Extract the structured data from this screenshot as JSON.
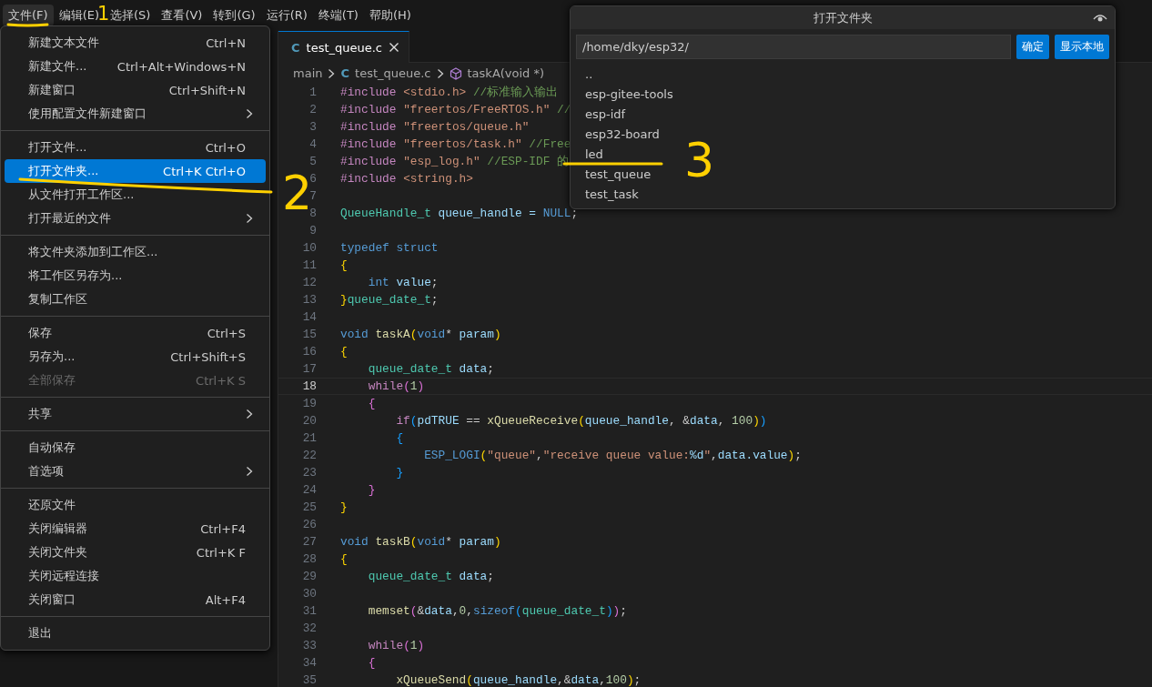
{
  "menu_bar": [
    {
      "label": "文件(F)",
      "selected": true
    },
    {
      "label": "编辑(E)",
      "selected": false
    },
    {
      "label": "选择(S)",
      "selected": false
    },
    {
      "label": "查看(V)",
      "selected": false
    },
    {
      "label": "转到(G)",
      "selected": false
    },
    {
      "label": "运行(R)",
      "selected": false
    },
    {
      "label": "终端(T)",
      "selected": false
    },
    {
      "label": "帮助(H)",
      "selected": false
    }
  ],
  "file_menu": [
    {
      "kind": "item",
      "label": "新建文本文件",
      "shortcut": "Ctrl+N",
      "submenu": false,
      "disabled": false,
      "selected": false
    },
    {
      "kind": "item",
      "label": "新建文件...",
      "shortcut": "Ctrl+Alt+Windows+N",
      "submenu": false,
      "disabled": false,
      "selected": false
    },
    {
      "kind": "item",
      "label": "新建窗口",
      "shortcut": "Ctrl+Shift+N",
      "submenu": false,
      "disabled": false,
      "selected": false
    },
    {
      "kind": "item",
      "label": "使用配置文件新建窗口",
      "submenu": true,
      "disabled": false,
      "selected": false
    },
    {
      "kind": "separator"
    },
    {
      "kind": "item",
      "label": "打开文件...",
      "shortcut": "Ctrl+O",
      "submenu": false,
      "disabled": false,
      "selected": false
    },
    {
      "kind": "item",
      "label": "打开文件夹...",
      "shortcut": "Ctrl+K Ctrl+O",
      "submenu": false,
      "disabled": false,
      "selected": true
    },
    {
      "kind": "item",
      "label": "从文件打开工作区...",
      "submenu": false,
      "disabled": false,
      "selected": false
    },
    {
      "kind": "item",
      "label": "打开最近的文件",
      "submenu": true,
      "disabled": false,
      "selected": false
    },
    {
      "kind": "separator"
    },
    {
      "kind": "item",
      "label": "将文件夹添加到工作区...",
      "submenu": false,
      "disabled": false,
      "selected": false
    },
    {
      "kind": "item",
      "label": "将工作区另存为...",
      "submenu": false,
      "disabled": false,
      "selected": false
    },
    {
      "kind": "item",
      "label": "复制工作区",
      "submenu": false,
      "disabled": false,
      "selected": false
    },
    {
      "kind": "separator"
    },
    {
      "kind": "item",
      "label": "保存",
      "shortcut": "Ctrl+S",
      "submenu": false,
      "disabled": false,
      "selected": false
    },
    {
      "kind": "item",
      "label": "另存为...",
      "shortcut": "Ctrl+Shift+S",
      "submenu": false,
      "disabled": false,
      "selected": false
    },
    {
      "kind": "item",
      "label": "全部保存",
      "shortcut": "Ctrl+K S",
      "submenu": false,
      "disabled": true,
      "selected": false
    },
    {
      "kind": "separator"
    },
    {
      "kind": "item",
      "label": "共享",
      "submenu": true,
      "disabled": false,
      "selected": false
    },
    {
      "kind": "separator"
    },
    {
      "kind": "item",
      "label": "自动保存",
      "submenu": false,
      "disabled": false,
      "selected": false
    },
    {
      "kind": "item",
      "label": "首选项",
      "submenu": true,
      "disabled": false,
      "selected": false
    },
    {
      "kind": "separator"
    },
    {
      "kind": "item",
      "label": "还原文件",
      "submenu": false,
      "disabled": false,
      "selected": false
    },
    {
      "kind": "item",
      "label": "关闭编辑器",
      "shortcut": "Ctrl+F4",
      "submenu": false,
      "disabled": false,
      "selected": false
    },
    {
      "kind": "item",
      "label": "关闭文件夹",
      "shortcut": "Ctrl+K F",
      "submenu": false,
      "disabled": false,
      "selected": false
    },
    {
      "kind": "item",
      "label": "关闭远程连接",
      "submenu": false,
      "disabled": false,
      "selected": false
    },
    {
      "kind": "item",
      "label": "关闭窗口",
      "shortcut": "Alt+F4",
      "submenu": false,
      "disabled": false,
      "selected": false
    },
    {
      "kind": "separator"
    },
    {
      "kind": "item",
      "label": "退出",
      "submenu": false,
      "disabled": false,
      "selected": false
    }
  ],
  "tabs": [
    {
      "file_icon": "C",
      "label": "test_queue.c",
      "selected": true
    }
  ],
  "breadcrumb": {
    "folder": "main",
    "file_icon": "C",
    "file": "test_queue.c",
    "symbol": "taskA(void *)"
  },
  "code": [
    {
      "n": "1",
      "current": false,
      "tokens": [
        {
          "text": "#include ",
          "kind": "dir"
        },
        {
          "text": "<stdio.h> ",
          "kind": "str"
        },
        {
          "text": "//标准输入输出",
          "kind": "com"
        }
      ]
    },
    {
      "n": "2",
      "current": false,
      "tokens": [
        {
          "text": "#include ",
          "kind": "dir"
        },
        {
          "text": "\"freertos/FreeRTOS.h\" ",
          "kind": "str"
        },
        {
          "text": "//",
          "kind": "com"
        }
      ]
    },
    {
      "n": "3",
      "current": false,
      "tokens": [
        {
          "text": "#include ",
          "kind": "dir"
        },
        {
          "text": "\"freertos/queue.h\"",
          "kind": "str"
        }
      ]
    },
    {
      "n": "4",
      "current": false,
      "tokens": [
        {
          "text": "#include ",
          "kind": "dir"
        },
        {
          "text": "\"freertos/task.h\" ",
          "kind": "str"
        },
        {
          "text": "//Free",
          "kind": "com"
        }
      ]
    },
    {
      "n": "5",
      "current": false,
      "tokens": [
        {
          "text": "#include ",
          "kind": "dir"
        },
        {
          "text": "\"esp_log.h\" ",
          "kind": "str"
        },
        {
          "text": "//ESP-IDF 的",
          "kind": "com"
        }
      ]
    },
    {
      "n": "6",
      "current": false,
      "tokens": [
        {
          "text": "#include ",
          "kind": "dir"
        },
        {
          "text": "<string.h>",
          "kind": "str"
        }
      ]
    },
    {
      "n": "7",
      "current": false
    },
    {
      "n": "8",
      "current": false,
      "tokens": [
        {
          "text": "QueueHandle_t ",
          "kind": "type"
        },
        {
          "text": "queue_handle = ",
          "kind": "var"
        },
        {
          "text": "NULL",
          "kind": "kw"
        },
        {
          "text": ";",
          "kind": "p"
        }
      ]
    },
    {
      "n": "9",
      "current": false
    },
    {
      "n": "10",
      "current": false,
      "tokens": [
        {
          "text": "typedef struct",
          "kind": "kw"
        }
      ]
    },
    {
      "n": "11",
      "current": false,
      "tokens": [
        {
          "text": "{",
          "kind": "b1"
        }
      ]
    },
    {
      "n": "12",
      "current": false,
      "tokens": [
        {
          "text": "    int ",
          "kind": "kw"
        },
        {
          "text": "value",
          "kind": "var"
        },
        {
          "text": ";",
          "kind": "p"
        }
      ]
    },
    {
      "n": "13",
      "current": false,
      "tokens": [
        {
          "text": "}",
          "kind": "b1"
        },
        {
          "text": "queue_date_t",
          "kind": "type"
        },
        {
          "text": ";",
          "kind": "p"
        }
      ]
    },
    {
      "n": "14",
      "current": false
    },
    {
      "n": "15",
      "current": false,
      "tokens": [
        {
          "text": "void ",
          "kind": "kw"
        },
        {
          "text": "taskA",
          "kind": "fn"
        },
        {
          "text": "(",
          "kind": "b1"
        },
        {
          "text": "void",
          "kind": "kw"
        },
        {
          "text": "* ",
          "kind": "p"
        },
        {
          "text": "param",
          "kind": "var"
        },
        {
          "text": ")",
          "kind": "b1"
        }
      ]
    },
    {
      "n": "16",
      "current": false,
      "tokens": [
        {
          "text": "{",
          "kind": "b1"
        }
      ]
    },
    {
      "n": "17",
      "current": false,
      "tokens": [
        {
          "text": "    queue_date_t ",
          "kind": "type"
        },
        {
          "text": "data",
          "kind": "var"
        },
        {
          "text": ";",
          "kind": "p"
        }
      ]
    },
    {
      "n": "18",
      "current": true,
      "tokens": [
        {
          "text": "    while",
          "kind": "ctl"
        },
        {
          "text": "(",
          "kind": "b2"
        },
        {
          "text": "1",
          "kind": "num"
        },
        {
          "text": ")",
          "kind": "b2"
        }
      ]
    },
    {
      "n": "19",
      "current": false,
      "tokens": [
        {
          "text": "    {",
          "kind": "b2"
        }
      ]
    },
    {
      "n": "20",
      "current": false,
      "tokens": [
        {
          "text": "        if",
          "kind": "ctl"
        },
        {
          "text": "(",
          "kind": "b3"
        },
        {
          "text": "pdTRUE",
          "kind": "var"
        },
        {
          "text": " == ",
          "kind": "p"
        },
        {
          "text": "xQueueReceive",
          "kind": "fn"
        },
        {
          "text": "(",
          "kind": "b1"
        },
        {
          "text": "queue_handle",
          "kind": "var"
        },
        {
          "text": ", &",
          "kind": "p"
        },
        {
          "text": "data",
          "kind": "var"
        },
        {
          "text": ", ",
          "kind": "p"
        },
        {
          "text": "100",
          "kind": "num"
        },
        {
          "text": ")",
          "kind": "b1"
        },
        {
          "text": ")",
          "kind": "b3"
        }
      ]
    },
    {
      "n": "21",
      "current": false,
      "tokens": [
        {
          "text": "        {",
          "kind": "b3"
        }
      ]
    },
    {
      "n": "22",
      "current": false,
      "tokens": [
        {
          "text": "            ESP_LOGI",
          "kind": "kw"
        },
        {
          "text": "(",
          "kind": "b1"
        },
        {
          "text": "\"queue\"",
          "kind": "str"
        },
        {
          "text": ",",
          "kind": "p"
        },
        {
          "text": "\"receive queue value:",
          "kind": "str"
        },
        {
          "text": "%d",
          "kind": "var"
        },
        {
          "text": "\"",
          "kind": "str"
        },
        {
          "text": ",",
          "kind": "p"
        },
        {
          "text": "data.value",
          "kind": "var"
        },
        {
          "text": ")",
          "kind": "b1"
        },
        {
          "text": ";",
          "kind": "p"
        }
      ]
    },
    {
      "n": "23",
      "current": false,
      "tokens": [
        {
          "text": "        }",
          "kind": "b3"
        }
      ]
    },
    {
      "n": "24",
      "current": false,
      "tokens": [
        {
          "text": "    }",
          "kind": "b2"
        }
      ]
    },
    {
      "n": "25",
      "current": false,
      "tokens": [
        {
          "text": "}",
          "kind": "b1"
        }
      ]
    },
    {
      "n": "26",
      "current": false
    },
    {
      "n": "27",
      "current": false,
      "tokens": [
        {
          "text": "void ",
          "kind": "kw"
        },
        {
          "text": "taskB",
          "kind": "fn"
        },
        {
          "text": "(",
          "kind": "b1"
        },
        {
          "text": "void",
          "kind": "kw"
        },
        {
          "text": "* ",
          "kind": "p"
        },
        {
          "text": "param",
          "kind": "var"
        },
        {
          "text": ")",
          "kind": "b1"
        }
      ]
    },
    {
      "n": "28",
      "current": false,
      "tokens": [
        {
          "text": "{",
          "kind": "b1"
        }
      ]
    },
    {
      "n": "29",
      "current": false,
      "tokens": [
        {
          "text": "    queue_date_t ",
          "kind": "type"
        },
        {
          "text": "data",
          "kind": "var"
        },
        {
          "text": ";",
          "kind": "p"
        }
      ]
    },
    {
      "n": "30",
      "current": false
    },
    {
      "n": "31",
      "current": false,
      "tokens": [
        {
          "text": "    memset",
          "kind": "fn"
        },
        {
          "text": "(",
          "kind": "b2"
        },
        {
          "text": "&",
          "kind": "p"
        },
        {
          "text": "data",
          "kind": "var"
        },
        {
          "text": ",",
          "kind": "p"
        },
        {
          "text": "0",
          "kind": "num"
        },
        {
          "text": ",",
          "kind": "p"
        },
        {
          "text": "sizeof",
          "kind": "kw"
        },
        {
          "text": "(",
          "kind": "b3"
        },
        {
          "text": "queue_date_t",
          "kind": "type"
        },
        {
          "text": ")",
          "kind": "b3"
        },
        {
          "text": ")",
          "kind": "b2"
        },
        {
          "text": ";",
          "kind": "p"
        }
      ]
    },
    {
      "n": "32",
      "current": false
    },
    {
      "n": "33",
      "current": false,
      "tokens": [
        {
          "text": "    while",
          "kind": "ctl"
        },
        {
          "text": "(",
          "kind": "b2"
        },
        {
          "text": "1",
          "kind": "num"
        },
        {
          "text": ")",
          "kind": "b2"
        }
      ]
    },
    {
      "n": "34",
      "current": false,
      "tokens": [
        {
          "text": "    {",
          "kind": "b2"
        }
      ]
    },
    {
      "n": "35",
      "current": false,
      "tokens": [
        {
          "text": "        xQueueSend",
          "kind": "fn"
        },
        {
          "text": "(",
          "kind": "b1"
        },
        {
          "text": "queue_handle",
          "kind": "var"
        },
        {
          "text": ",&",
          "kind": "p"
        },
        {
          "text": "data",
          "kind": "var"
        },
        {
          "text": ",",
          "kind": "p"
        },
        {
          "text": "100",
          "kind": "num"
        },
        {
          "text": ")",
          "kind": "b1"
        },
        {
          "text": ";",
          "kind": "p"
        }
      ]
    }
  ],
  "open_folder_dialog": {
    "title": "打开文件夹",
    "path": "/home/dky/esp32/",
    "buttons": [
      "确定",
      "显示本地"
    ],
    "entries": [
      "..",
      "esp-gitee-tools",
      "esp-idf",
      "esp32-board",
      "led",
      "test_queue",
      "test_task"
    ]
  },
  "annotations": [
    {
      "label": "1"
    },
    {
      "label": "2"
    },
    {
      "label": "3"
    }
  ]
}
